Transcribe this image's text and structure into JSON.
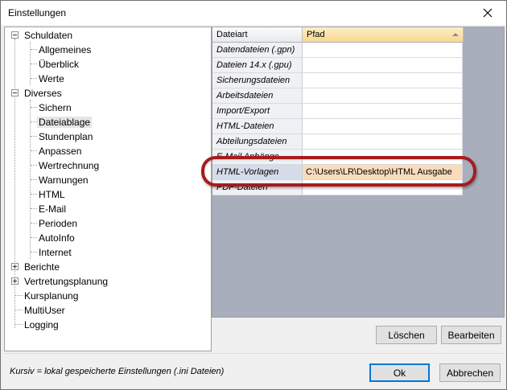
{
  "window": {
    "title": "Einstellungen"
  },
  "tree": {
    "schuldaten": {
      "label": "Schuldaten",
      "children": [
        "Allgemeines",
        "Überblick",
        "Werte"
      ]
    },
    "diverses": {
      "label": "Diverses",
      "children": [
        "Sichern",
        "Dateiablage",
        "Stundenplan",
        "Anpassen",
        "Wertrechnung",
        "Warnungen",
        "HTML",
        "E-Mail",
        "Perioden",
        "AutoInfo",
        "Internet"
      ],
      "selected": "Dateiablage"
    },
    "berichte": "Berichte",
    "vertretungsplanung": "Vertretungsplanung",
    "kursplanung": "Kursplanung",
    "multiuser": "MultiUser",
    "logging": "Logging"
  },
  "grid": {
    "headers": {
      "type": "Dateiart",
      "path": "Pfad"
    },
    "rows": [
      {
        "type": "Datendateien (.gpn)",
        "path": ""
      },
      {
        "type": "Dateien 14.x (.gpu)",
        "path": ""
      },
      {
        "type": "Sicherungsdateien",
        "path": ""
      },
      {
        "type": "Arbeitsdateien",
        "path": ""
      },
      {
        "type": "Import/Export",
        "path": ""
      },
      {
        "type": "HTML-Dateien",
        "path": ""
      },
      {
        "type": "Abteilungsdateien",
        "path": ""
      },
      {
        "type": "E-Mail Anhänge",
        "path": ""
      },
      {
        "type": "HTML-Vorlagen",
        "path": "C:\\Users\\LR\\Desktop\\HTML Ausgabe"
      },
      {
        "type": "PDF-Dateien",
        "path": ""
      }
    ],
    "highlight_color": "#a61c1c"
  },
  "buttons": {
    "delete": "Löschen",
    "edit": "Bearbeiten",
    "ok": "Ok",
    "cancel": "Abbrechen"
  },
  "status": {
    "text": "Kursiv = lokal gespeicherte Einstellungen (.ini Dateien)"
  }
}
